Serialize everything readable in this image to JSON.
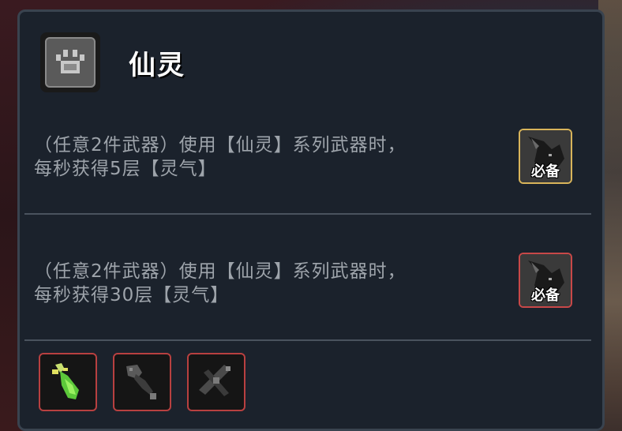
{
  "set": {
    "icon": "paw-icon",
    "title": "仙灵"
  },
  "effects": [
    {
      "line1": "（任意2件武器）使用【仙灵】系列武器时，",
      "line2": "每秒获得5层【灵气】",
      "badge_label": "必备",
      "badge_icon": "wolf-portrait-icon",
      "badge_border_color": "#d8b45a"
    },
    {
      "line1": "（任意2件武器）使用【仙灵】系列武器时，",
      "line2": "每秒获得30层【灵气】",
      "badge_label": "必备",
      "badge_icon": "wolf-portrait-icon",
      "badge_border_color": "#c84848"
    }
  ],
  "weapons": [
    {
      "icon": "green-glowing-sword-icon",
      "color": "#7ee04a"
    },
    {
      "icon": "dark-spiked-mace-icon",
      "color": "#6a6a6a"
    },
    {
      "icon": "dark-crossbow-icon",
      "color": "#6a6a6a"
    }
  ],
  "colors": {
    "panel_bg": "#1b222c",
    "text": "#9ea4ab",
    "title": "#ffffff",
    "slot_border": "#b84040"
  }
}
